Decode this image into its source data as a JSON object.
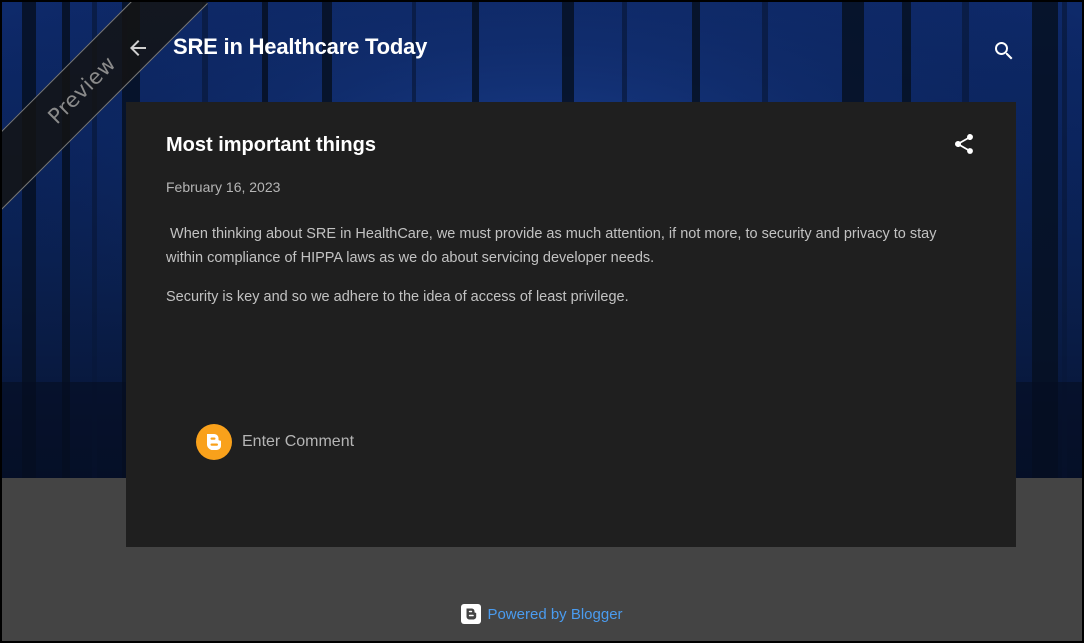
{
  "header": {
    "preview_label": "Preview",
    "blog_title": "SRE in Healthcare Today"
  },
  "post": {
    "title": "Most important things",
    "date": "February 16, 2023",
    "paragraphs": [
      " When thinking about SRE in HealthCare, we must provide as much attention, if not more, to security and privacy to stay within compliance of HIPPA laws as we do about servicing developer needs.",
      "Security is key and so we adhere to the idea of access of least privilege."
    ]
  },
  "comments": {
    "placeholder": "Enter Comment"
  },
  "footer": {
    "powered_by": "Powered by Blogger"
  },
  "icons": {
    "back": "arrow-back-icon",
    "search": "search-icon",
    "share": "share-icon",
    "blogger": "blogger-icon"
  },
  "colors": {
    "card_background": "#1f1f1f",
    "page_background": "#444444",
    "blogger_orange": "#f9a11b",
    "link_blue": "#4a9cf0"
  }
}
